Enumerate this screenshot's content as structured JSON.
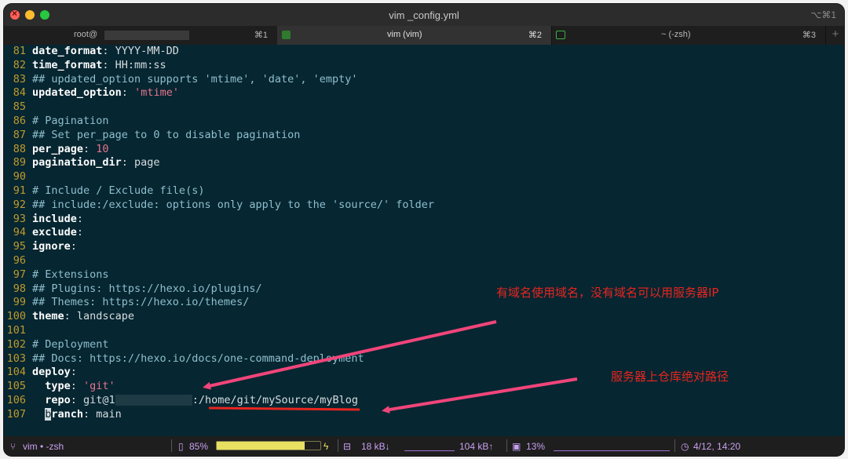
{
  "window": {
    "title": "vim _config.yml",
    "shortcut": "⌥⌘1"
  },
  "tabs": [
    {
      "label": "root@",
      "shortcut": "⌘1"
    },
    {
      "label": "vim (vim)",
      "shortcut": "⌘2"
    },
    {
      "label": "~ (-zsh)",
      "shortcut": "⌘3"
    }
  ],
  "tab_plus": "+",
  "editor": {
    "lines": [
      {
        "n": "81",
        "parts": [
          {
            "t": "date_format",
            "c": "k"
          },
          {
            "t": ": YYYY-MM-DD",
            "c": "v"
          }
        ]
      },
      {
        "n": "82",
        "parts": [
          {
            "t": "time_format",
            "c": "k"
          },
          {
            "t": ": HH:mm:ss",
            "c": "v"
          }
        ]
      },
      {
        "n": "83",
        "parts": [
          {
            "t": "## updated_option supports 'mtime', 'date', 'empty'",
            "c": "c"
          }
        ]
      },
      {
        "n": "84",
        "parts": [
          {
            "t": "updated_option",
            "c": "k"
          },
          {
            "t": ": ",
            "c": "v"
          },
          {
            "t": "'mtime'",
            "c": "s"
          }
        ]
      },
      {
        "n": "85",
        "parts": []
      },
      {
        "n": "86",
        "parts": [
          {
            "t": "# Pagination",
            "c": "c"
          }
        ]
      },
      {
        "n": "87",
        "parts": [
          {
            "t": "## Set per_page to 0 to disable pagination",
            "c": "c"
          }
        ]
      },
      {
        "n": "88",
        "parts": [
          {
            "t": "per_page",
            "c": "k"
          },
          {
            "t": ": ",
            "c": "v"
          },
          {
            "t": "10",
            "c": "n"
          }
        ]
      },
      {
        "n": "89",
        "parts": [
          {
            "t": "pagination_dir",
            "c": "k"
          },
          {
            "t": ": page",
            "c": "v"
          }
        ]
      },
      {
        "n": "90",
        "parts": []
      },
      {
        "n": "91",
        "parts": [
          {
            "t": "# Include / Exclude file(s)",
            "c": "c"
          }
        ]
      },
      {
        "n": "92",
        "parts": [
          {
            "t": "## include:/exclude: options only apply to the 'source/' folder",
            "c": "c"
          }
        ]
      },
      {
        "n": "93",
        "parts": [
          {
            "t": "include",
            "c": "k"
          },
          {
            "t": ":",
            "c": "v"
          }
        ]
      },
      {
        "n": "94",
        "parts": [
          {
            "t": "exclude",
            "c": "k"
          },
          {
            "t": ":",
            "c": "v"
          }
        ]
      },
      {
        "n": "95",
        "parts": [
          {
            "t": "ignore",
            "c": "k"
          },
          {
            "t": ":",
            "c": "v"
          }
        ]
      },
      {
        "n": "96",
        "parts": []
      },
      {
        "n": "97",
        "parts": [
          {
            "t": "# Extensions",
            "c": "c"
          }
        ]
      },
      {
        "n": "98",
        "parts": [
          {
            "t": "## Plugins: https://hexo.io/plugins/",
            "c": "c"
          }
        ]
      },
      {
        "n": "99",
        "parts": [
          {
            "t": "## Themes: https://hexo.io/themes/",
            "c": "c"
          }
        ]
      },
      {
        "n": "100",
        "parts": [
          {
            "t": "theme",
            "c": "k"
          },
          {
            "t": ": landscape",
            "c": "v"
          }
        ]
      },
      {
        "n": "101",
        "parts": []
      },
      {
        "n": "102",
        "parts": [
          {
            "t": "# Deployment",
            "c": "c"
          }
        ]
      },
      {
        "n": "103",
        "parts": [
          {
            "t": "## Docs: https://hexo.io/docs/one-command-deployment",
            "c": "c"
          }
        ]
      },
      {
        "n": "104",
        "parts": [
          {
            "t": "deploy",
            "c": "k"
          },
          {
            "t": ":",
            "c": "v"
          }
        ]
      },
      {
        "n": "105",
        "parts": [
          {
            "t": "  type",
            "c": "k"
          },
          {
            "t": ": ",
            "c": "v"
          },
          {
            "t": "'git'",
            "c": "s"
          }
        ]
      },
      {
        "n": "106",
        "parts": [
          {
            "t": "  repo",
            "c": "k"
          },
          {
            "t": ": git@1",
            "c": "v"
          },
          {
            "t": "",
            "c": "redact"
          },
          {
            "t": ":/home/git/mySource/myBlog",
            "c": "v"
          }
        ]
      },
      {
        "n": "107",
        "parts": [
          {
            "t": "  ",
            "c": "v"
          },
          {
            "t": "b",
            "c": "cursor"
          },
          {
            "t": "ranch",
            "c": "k"
          },
          {
            "t": ": main",
            "c": "v"
          }
        ]
      }
    ]
  },
  "annotations": {
    "domain_note": "有域名使用域名，没有域名可以用服务器IP",
    "path_note": "服务器上仓库绝对路径"
  },
  "status": {
    "session": "vim • -zsh",
    "battery": "85%",
    "battery_level": 0.85,
    "net_down": "18 kB↓",
    "net_up": "104 kB↑",
    "cpu": "13%",
    "datetime": "4/12, 14:20"
  },
  "colors": {
    "background": "#062631",
    "line_number": "#bf9a2e",
    "comment": "#8fbfce",
    "string": "#e5748c",
    "annotation": "#e8251f",
    "arrow": "#f0457a"
  },
  "icons": {
    "battery": "battery-icon",
    "branch": "branch-icon",
    "network": "network-icon",
    "cpu": "cpu-icon",
    "clock": "clock-icon"
  }
}
